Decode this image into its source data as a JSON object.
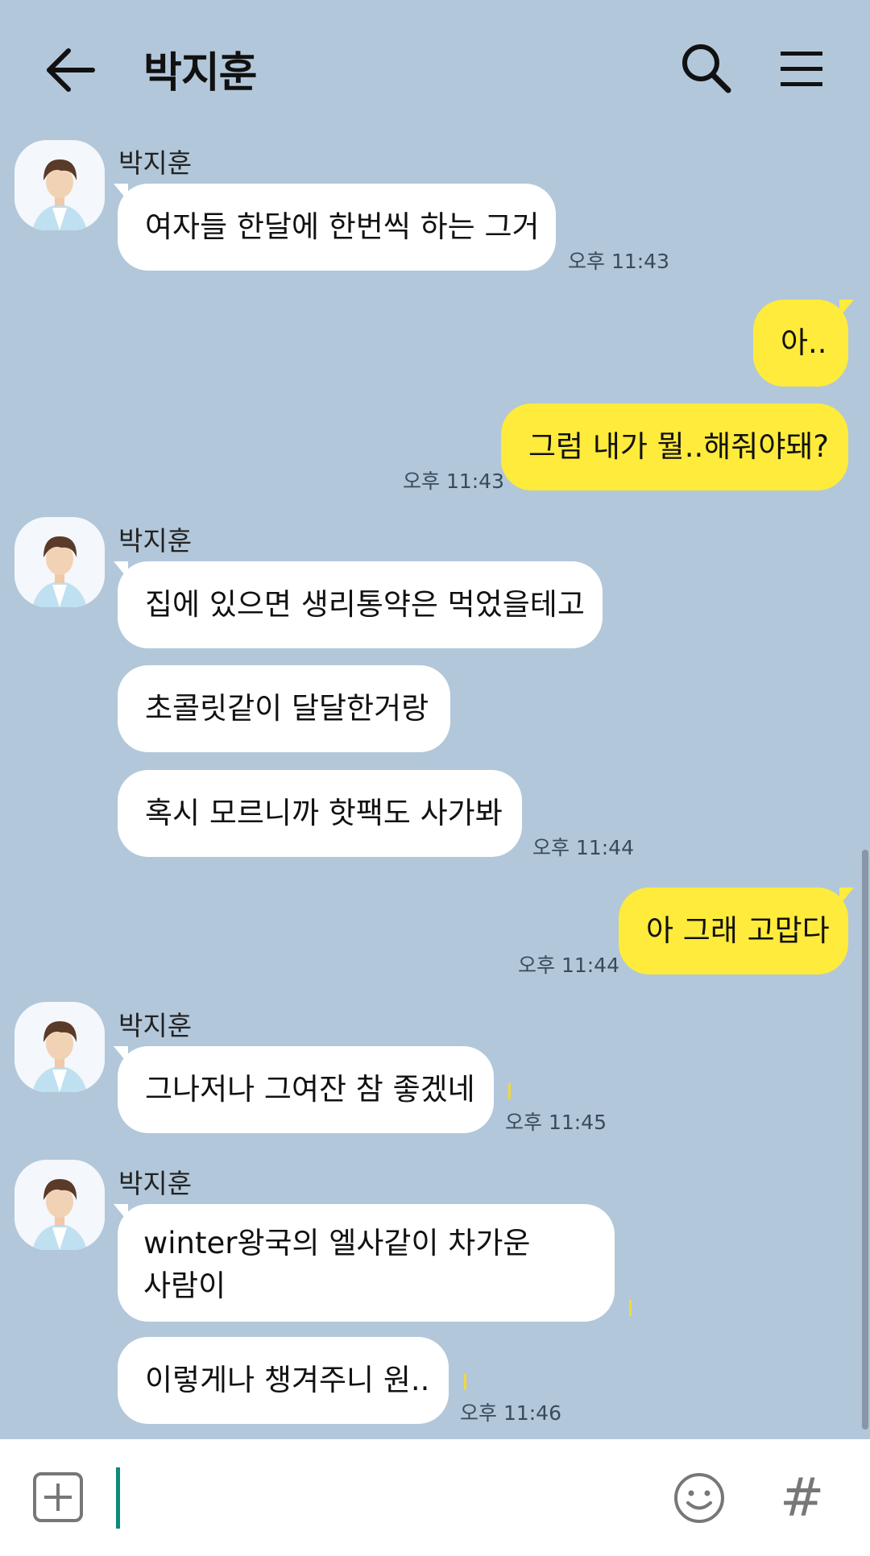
{
  "header": {
    "title": "박지훈",
    "back_icon": "arrow-left-icon",
    "search_icon": "search-icon",
    "menu_icon": "hamburger-menu-icon"
  },
  "colors": {
    "background": "#B2C7DA",
    "incoming_bubble": "#FFFFFF",
    "outgoing_bubble": "#FFEB3B",
    "caret": "#0E8A7A"
  },
  "messages": [
    {
      "direction": "in",
      "sender": "박지훈",
      "text": "여자들 한달에 한번씩 하는 그거",
      "time": "오후 11:43"
    },
    {
      "direction": "out",
      "text": "아.."
    },
    {
      "direction": "out",
      "text": "그럼 내가 뭘..해줘야돼?",
      "time": "오후 11:43"
    },
    {
      "direction": "in",
      "sender": "박지훈",
      "text": "집에 있으면 생리통약은 먹었을테고"
    },
    {
      "direction": "in",
      "text": "초콜릿같이 달달한거랑"
    },
    {
      "direction": "in",
      "text": "혹시 모르니까 핫팩도 사가봐",
      "time": "오후 11:44"
    },
    {
      "direction": "out",
      "text": "아 그래 고맙다",
      "time": "오후 11:44"
    },
    {
      "direction": "in",
      "sender": "박지훈",
      "text": "그나저나 그여잔 참 좋겠네",
      "time": "오후 11:45"
    },
    {
      "direction": "in",
      "sender": "박지훈",
      "text_line1": "winter왕국의 엘사같이 차가운",
      "text_line2": "사람이"
    },
    {
      "direction": "in",
      "text": "이렇게나 챙겨주니 원..",
      "time": "오후 11:46"
    }
  ],
  "input": {
    "value": "",
    "attach_icon": "plus-box-icon",
    "emoji_icon": "emoji-smile-icon",
    "hash_label": "#"
  }
}
